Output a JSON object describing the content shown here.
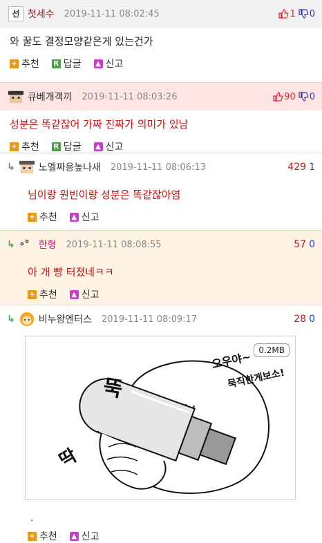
{
  "comments": [
    {
      "nick": "첫세수",
      "date": "2019-11-11 08:02:45",
      "up": "1",
      "down": "0",
      "text": "와 꿀도 결정모양같은게 있는건가",
      "actions": [
        "추천",
        "답글",
        "신고"
      ]
    },
    {
      "nick": "큐베개객끼",
      "date": "2019-11-11 08:03:26",
      "up": "90",
      "down": "0",
      "text": "성분은 똑같잖어 가짜 진짜가 의미가 있남",
      "actions": [
        "추천",
        "답글",
        "신고"
      ]
    },
    {
      "nick": "노엘짜응높나새",
      "date": "2019-11-11 08:06:13",
      "up": "429",
      "down": "1",
      "text": "님이랑 원빈이랑 성분은 똑같잖아염",
      "actions": [
        "추천",
        "신고"
      ]
    },
    {
      "nick": "한형",
      "date": "2019-11-11 08:08:55",
      "up": "57",
      "down": "0",
      "text": "아 개 빵 터졌네ㅋㅋ",
      "actions": [
        "추천",
        "신고"
      ]
    },
    {
      "nick": "비누왕엔터스",
      "date": "2019-11-11 08:09:17",
      "up": "28",
      "down": "0",
      "image_size": "0.2MB",
      "image_text": [
        "오우야~",
        "묵직한게보소!",
        "뚝",
        "딱"
      ],
      "text": ".",
      "actions": [
        "추천",
        "신고"
      ]
    }
  ],
  "icons": {
    "reply_arrow": "↳",
    "report": "siren-icon",
    "recommend": "plus-icon"
  },
  "colors": {
    "highlight_header": "#ffe4e4",
    "reply_highlight": "#fff3e4",
    "red_text": "#d01010"
  }
}
